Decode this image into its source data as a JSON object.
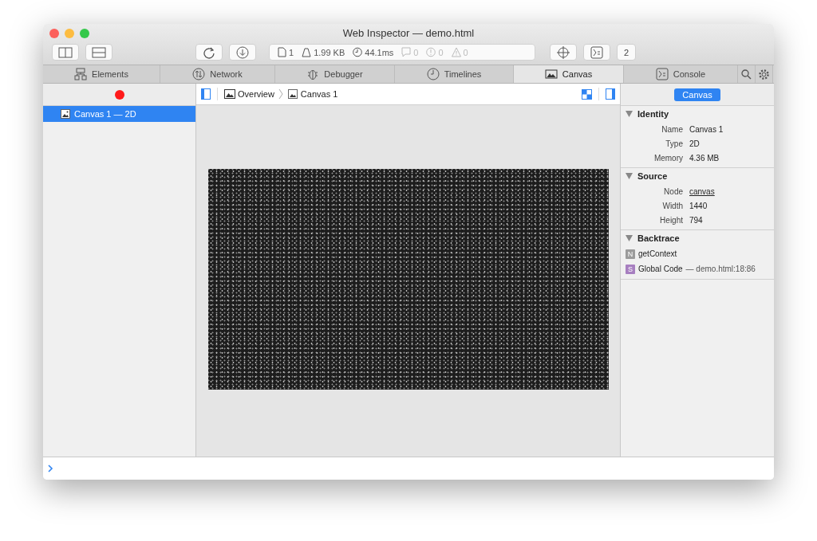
{
  "window": {
    "title": "Web Inspector — demo.html"
  },
  "toolbar": {
    "activity": [
      {
        "kind": "resources",
        "text": "1",
        "disabled": false
      },
      {
        "kind": "size",
        "text": "1.99 KB",
        "disabled": false
      },
      {
        "kind": "time",
        "text": "44.1ms",
        "disabled": false
      },
      {
        "kind": "messages",
        "text": "0",
        "disabled": true
      },
      {
        "kind": "errors",
        "text": "0",
        "disabled": true
      },
      {
        "kind": "warnings",
        "text": "0",
        "disabled": true
      }
    ],
    "count": "2"
  },
  "tabs": [
    {
      "kind": "elements",
      "label": "Elements",
      "selected": false
    },
    {
      "kind": "network",
      "label": "Network",
      "selected": false
    },
    {
      "kind": "debugger",
      "label": "Debugger",
      "selected": false
    },
    {
      "kind": "timelines",
      "label": "Timelines",
      "selected": false
    },
    {
      "kind": "canvas",
      "label": "Canvas",
      "selected": true
    },
    {
      "kind": "console",
      "label": "Console",
      "selected": false
    }
  ],
  "sidebar": {
    "recording": true,
    "items": [
      {
        "label": "Canvas 1 — 2D",
        "selected": true
      }
    ]
  },
  "breadcrumb": [
    "Overview",
    "Canvas 1"
  ],
  "details": {
    "button": "Canvas",
    "sections": [
      {
        "title": "Identity",
        "expanded": true,
        "rows": [
          {
            "label": "Name",
            "value": "Canvas 1",
            "kind": "text"
          },
          {
            "label": "Type",
            "value": "2D",
            "kind": "text"
          },
          {
            "label": "Memory",
            "value": "4.36 MB",
            "kind": "text"
          }
        ]
      },
      {
        "title": "Source",
        "expanded": true,
        "rows": [
          {
            "label": "Node",
            "value": "canvas",
            "kind": "link"
          },
          {
            "label": "Width",
            "value": "1440",
            "kind": "text"
          },
          {
            "label": "Height",
            "value": "794",
            "kind": "text"
          }
        ]
      }
    ],
    "backtrace": {
      "title": "Backtrace",
      "expanded": true,
      "frames": [
        {
          "badge": "N",
          "name": "getContext",
          "color": "#9b9b9b"
        },
        {
          "badge": "S",
          "name": "Global Code",
          "location": "— demo.html:18:86",
          "color": "#a77fc0"
        }
      ]
    }
  }
}
